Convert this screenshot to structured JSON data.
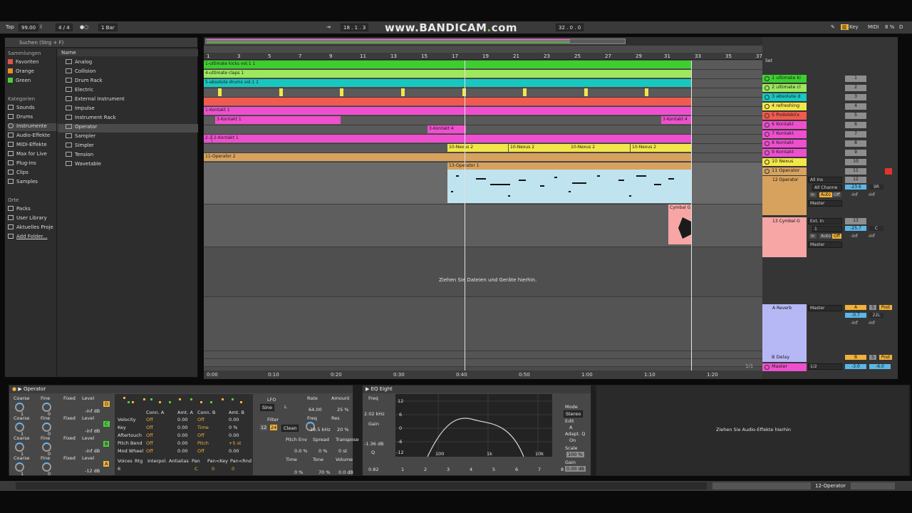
{
  "colors": {
    "green": "#3ccf2e",
    "lightgreen": "#9ee85c",
    "teal": "#18c7c0",
    "yellow": "#f3e64a",
    "red": "#f15a4f",
    "pink": "#ef4fcf",
    "orange": "#d7a25e",
    "lightblue": "#bfe3ef",
    "salmon": "#f7a5a5",
    "lavender": "#b6b8f5",
    "accent": "#f0b23a"
  },
  "transport": {
    "tap": "Tap",
    "tempo": "99.00",
    "meter": "4 / 4",
    "quant": "1 Bar",
    "position": "18 .  1 .  3",
    "loop_length": "32 .  0 .  0",
    "key": "Key",
    "midi": "MIDI",
    "cpu": "8 %",
    "d": "D"
  },
  "watermark": {
    "pre": "www.",
    "brand": "BANDICAM",
    "post": "com"
  },
  "browser": {
    "search_placeholder": "Suchen (Strg + F)",
    "sammlungen": "Sammlungen",
    "collections": [
      "Favoriten",
      "Orange",
      "Green"
    ],
    "kategorien": "Kategorien",
    "categories": [
      "Sounds",
      "Drums",
      "Instrumente",
      "Audio-Effekte",
      "MIDI-Effekte",
      "Max for Live",
      "Plug-ins",
      "Clips",
      "Samples"
    ],
    "orte": "Orte",
    "places": [
      "Packs",
      "User Library",
      "Aktuelles Proje",
      "Add Folder..."
    ],
    "name_header": "Name",
    "items": [
      "Analog",
      "Collision",
      "Drum Rack",
      "Electric",
      "External Instrument",
      "Impulse",
      "Instrument Rack",
      "Operator",
      "Sampler",
      "Simpler",
      "Tension",
      "Wavetable"
    ]
  },
  "arrangement": {
    "ruler": [
      "1",
      "3",
      "5",
      "7",
      "9",
      "11",
      "13",
      "15",
      "17",
      "19",
      "21",
      "23",
      "25",
      "27",
      "29",
      "31",
      "33",
      "35",
      "37"
    ],
    "time": [
      "0:00",
      "0:10",
      "0:20",
      "0:30",
      "0:40",
      "0:50",
      "1:00",
      "1:10",
      "1:20"
    ],
    "clips": {
      "c1": "1-ultimate kicks vol.1 1",
      "c2": "4-ultimate claps 1",
      "c3": "5-absolute drums vol.1 1",
      "c4": "1-Kontakt 1",
      "c5": "3-Kontakt 1",
      "c6": "3-Kontakt 4",
      "c7": "3-Kontakt 4",
      "c8": "2-Kontakt 1",
      "c9": "2-1",
      "n1": "10-Nexus 2",
      "n2": "10-Nexus 2",
      "n3": "10-Nexus 2",
      "n4": "10-Nexus 2",
      "c10": "11-Operator 2",
      "c11": "13-Operator 1",
      "c12": "Cymbal G"
    },
    "drop_hint": "Ziehen Sie Dateien und Geräte hierhin.",
    "zoom": "1/1"
  },
  "mixer": {
    "set": "Set",
    "tracks": [
      {
        "name": "1 ultimate ki",
        "num": "1"
      },
      {
        "name": "2 ultimate cl",
        "num": "2"
      },
      {
        "name": "3 absolute d",
        "num": "3"
      },
      {
        "name": "4 refreshing",
        "num": "4"
      },
      {
        "name": "5 Podolski(x",
        "num": "5"
      },
      {
        "name": "6 Kontakt",
        "num": "6"
      },
      {
        "name": "7 Kontakt",
        "num": "7"
      },
      {
        "name": "8 Kontakt",
        "num": "8"
      },
      {
        "name": "9 Kontakt",
        "num": "9"
      },
      {
        "name": "10 Nexus",
        "num": "10"
      },
      {
        "name": "11 Operator",
        "num": "11"
      }
    ],
    "t12": {
      "name": "12 Operator",
      "input": "All Ins",
      "channel": "All Channe",
      "in": "In",
      "auto": "Auto",
      "off": "Off",
      "out": "Master",
      "num": "12",
      "vol": "-23.6",
      "pan": "9R",
      "inf1": "-inf",
      "inf2": "-inf"
    },
    "t13": {
      "name": "13 Cymbal G",
      "input": "Ext. In",
      "channel": "1",
      "in": "In",
      "auto": "Auto",
      "off": "Off",
      "out": "Master",
      "num": "13",
      "vol": "-25.7",
      "pan": "C",
      "inf1": "-inf",
      "inf2": "-inf"
    },
    "ret_a": {
      "name": "A Reverb",
      "out": "Master",
      "letter": "A",
      "s": "S",
      "post": "Post",
      "vol": "-0.7",
      "pan": "22L",
      "inf1": "-inf",
      "inf2": "-inf"
    },
    "ret_b": {
      "name": "B Delay",
      "letter": "B",
      "s": "S",
      "post": "Post"
    },
    "master": {
      "name": "Master",
      "cue": "1/2",
      "vol": "-3.0",
      "pan": "-6.0"
    }
  },
  "devices": {
    "operator": {
      "title": "Operator",
      "osc_rows": [
        {
          "coarse": "1",
          "fine": "0",
          "level": "-inf dB",
          "letter": "D"
        },
        {
          "coarse": "1",
          "fine": "0",
          "level": "-inf dB",
          "letter": "C"
        },
        {
          "coarse": "1",
          "fine": "0",
          "level": "-inf dB",
          "letter": "B"
        },
        {
          "coarse": "1",
          "fine": "0",
          "level": "-12 dB",
          "letter": "A"
        }
      ],
      "h_coarse": "Coarse",
      "h_fine": "Fine",
      "h_fixed": "Fixed",
      "h_level": "Level",
      "matrix_head": [
        "Conn. A",
        "Amt. A",
        "Conn. B",
        "Amt. B"
      ],
      "matrix": [
        {
          "label": "Velocity",
          "a": "Off",
          "aa": "0.00",
          "b": "Off",
          "bb": "0.00"
        },
        {
          "label": "Key",
          "a": "Off",
          "aa": "0.00",
          "b": "Time",
          "bb": "0 %"
        },
        {
          "label": "Aftertouch",
          "a": "Off",
          "aa": "0.00",
          "b": "Off",
          "bb": "0.00"
        },
        {
          "label": "Pitch Bend",
          "a": "Off",
          "aa": "0.00",
          "b": "Pitch",
          "bb": "+5 st"
        },
        {
          "label": "Mod Wheel",
          "a": "Off",
          "aa": "0.00",
          "b": "Off",
          "bb": "0.00"
        }
      ],
      "bottom_head": [
        "Voices",
        "Rtg",
        "Interpol.",
        "Antialias",
        "Pan",
        "Pan<Key",
        "Pan<Rnd"
      ],
      "bottom_vals": [
        "6",
        "C",
        "0",
        "0"
      ],
      "lfo": "LFO",
      "lfo_wave": "Sine",
      "lfo_l": "L",
      "rate": "Rate",
      "rate_val": "64.00",
      "amount": "Amount",
      "amount_val": "25 %",
      "filter": "Filter",
      "f12": "12",
      "f24": "24",
      "clean": "Clean",
      "freq": "Freq",
      "freq_val": "18.5 kHz",
      "res": "Res",
      "res_val": "20 %",
      "pitch_env": "Pitch Env",
      "pe_val": "0.0 %",
      "spread": "Spread",
      "spread_val": "0 %",
      "transpose": "Transpose",
      "tr_val": "0 st",
      "time": "Time",
      "time_val": "0 %",
      "tone": "Tone",
      "tone_val": "70 %",
      "volume": "Volume",
      "vol_val": "0.0 dB"
    },
    "eq": {
      "title": "EQ Eight",
      "freq": "Freq",
      "freq_val": "2.02 kHz",
      "gain": "Gain",
      "gain_val": "-1.36 dB",
      "q": "Q",
      "q_val": "0.82",
      "db_ticks": [
        "12",
        "6",
        "0",
        "-6",
        "-12"
      ],
      "hz_ticks": [
        "100",
        "1k",
        "10k"
      ],
      "mode": "Mode",
      "mode_val": "Stereo",
      "edit": "Edit",
      "edit_val": "A",
      "adapt": "Adapt. Q",
      "adapt_val": "On",
      "scale": "Scale",
      "scale_val": "100 %",
      "out_gain": "Gain",
      "out_gain_val": "0.00 dB",
      "bands": [
        "1",
        "2",
        "3",
        "4",
        "5",
        "6",
        "7",
        "8"
      ]
    },
    "drop_hint": "Ziehen Sie Audio-Effekte hierhin"
  },
  "statusbar": {
    "track": "12-Operator"
  }
}
